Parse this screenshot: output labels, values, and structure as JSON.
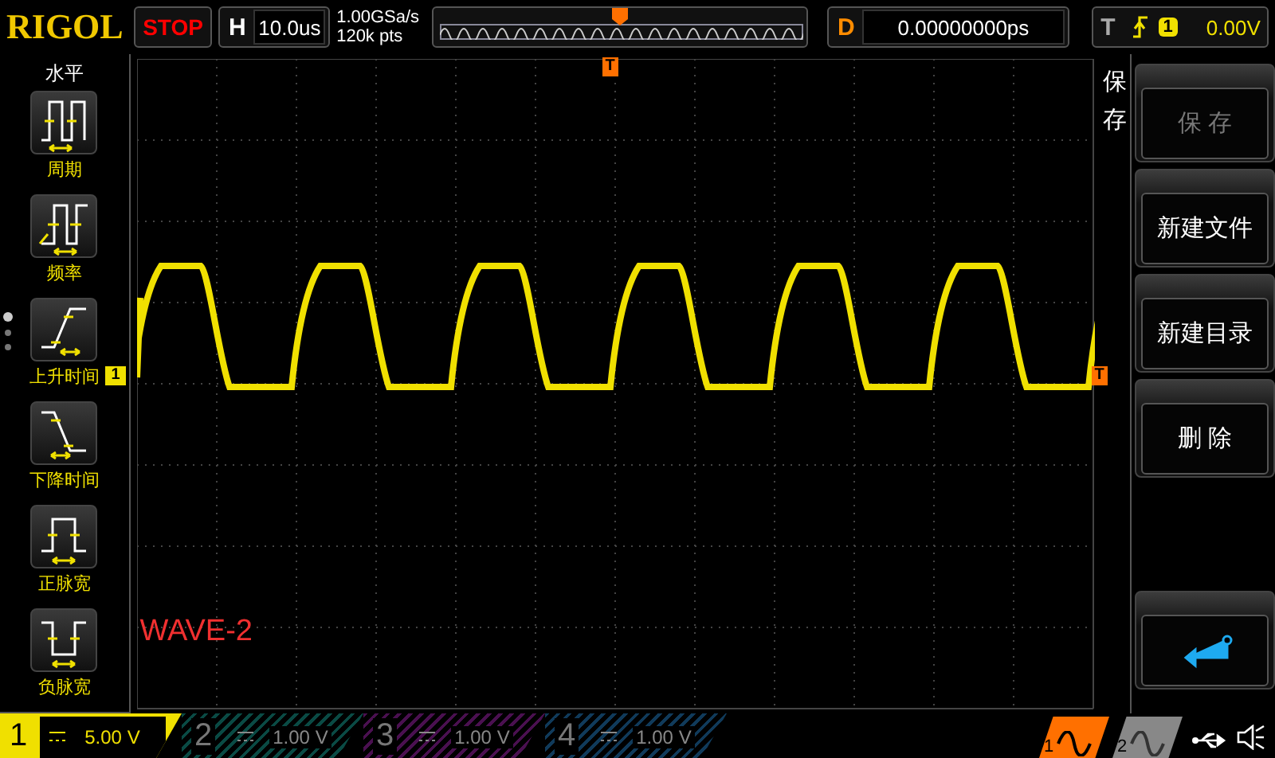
{
  "brand": "RIGOL",
  "run_state": "STOP",
  "horizontal": {
    "label": "H",
    "timebase": "10.0us"
  },
  "acquisition": {
    "sample_rate": "1.00GSa/s",
    "memory_depth": "120k pts"
  },
  "delay": {
    "label": "D",
    "value": "0.00000000ps"
  },
  "trigger": {
    "label": "T",
    "source": "1",
    "level": "0.00V"
  },
  "left_menu": {
    "title": "水平",
    "items": [
      {
        "label": "周期",
        "kind": "period"
      },
      {
        "label": "频率",
        "kind": "frequency"
      },
      {
        "label": "上升时间",
        "kind": "rise"
      },
      {
        "label": "下降时间",
        "kind": "fall"
      },
      {
        "label": "正脉宽",
        "kind": "pos_width"
      },
      {
        "label": "负脉宽",
        "kind": "neg_width"
      }
    ]
  },
  "screen": {
    "channel_marker": "1",
    "trigger_time_marker": "T",
    "trigger_level_marker": "T",
    "label": "WAVE-2"
  },
  "right_menu": {
    "title": "保存",
    "items": [
      {
        "label": "保 存",
        "kind": "text",
        "disabled": true
      },
      {
        "label": "新建文件",
        "kind": "text",
        "disabled": false
      },
      {
        "label": "新建目录",
        "kind": "text",
        "disabled": false
      },
      {
        "label": "删 除",
        "kind": "text",
        "disabled": false
      },
      {
        "kind": "spacer"
      },
      {
        "kind": "enter"
      }
    ]
  },
  "channels": [
    {
      "number": "1",
      "scale": "5.00 V",
      "on": true,
      "color": "#f0e000"
    },
    {
      "number": "2",
      "scale": "1.00 V",
      "on": false,
      "color": "#0a4a44"
    },
    {
      "number": "3",
      "scale": "1.00 V",
      "on": false,
      "color": "#4a1050"
    },
    {
      "number": "4",
      "scale": "1.00 V",
      "on": false,
      "color": "#103a5a"
    }
  ],
  "sources": [
    {
      "number": "1",
      "selected": true
    },
    {
      "number": "2",
      "selected": false
    }
  ]
}
